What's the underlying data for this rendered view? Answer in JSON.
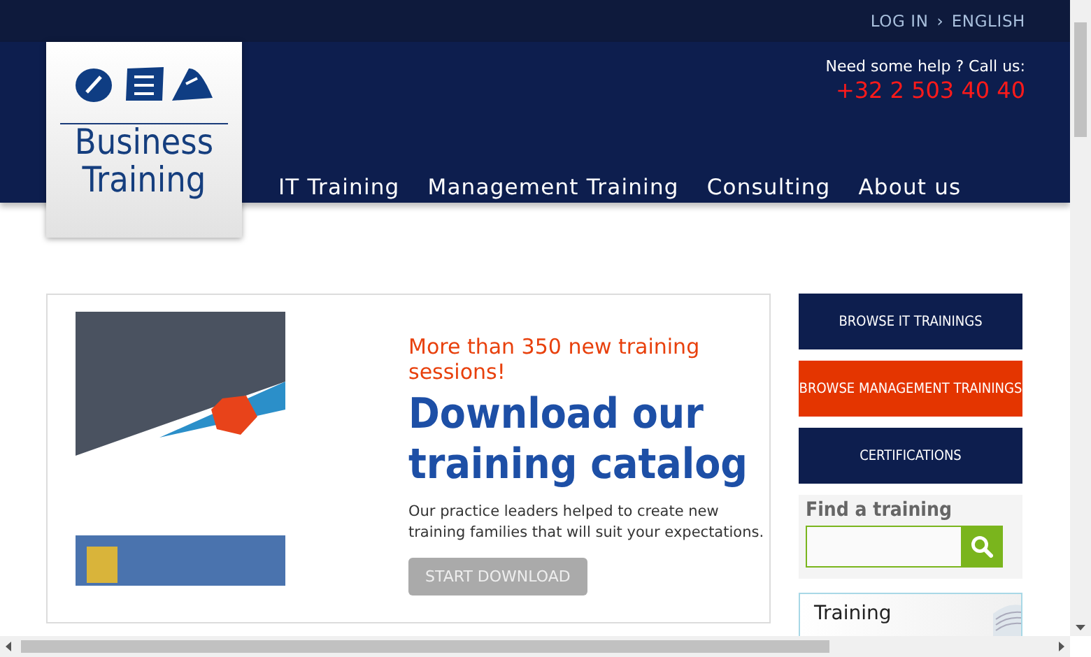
{
  "top_bar": {
    "links": [
      "LOG IN",
      "ENGLISH"
    ],
    "separator": "›"
  },
  "header": {
    "logo_text": [
      "Business",
      "Training"
    ],
    "help_text": "Need some help ? Call us:",
    "phone": "+32 2 503 40 40",
    "nav": [
      {
        "label": "IT Training"
      },
      {
        "label": "Management Training"
      },
      {
        "label": "Consulting"
      },
      {
        "label": "About us"
      }
    ]
  },
  "promo": {
    "tagline": "More than 350 new training sessions!",
    "title": "Download our training catalog",
    "text": "Our practice leaders helped to create new training families that will suit your expectations.",
    "button": {
      "label": "START DOWNLOAD",
      "disabled": true
    }
  },
  "sidebar": {
    "buttons": [
      {
        "label": "BROWSE IT TRAININGS",
        "color": "#0d1e4e"
      },
      {
        "label": "BROWSE MANAGEMENT TRAININGS",
        "color": "#e43500"
      },
      {
        "label": "CERTIFICATIONS",
        "color": "#0d1e4e"
      }
    ],
    "search": {
      "title": "Find a training"
    },
    "card": {
      "title": "Training"
    }
  }
}
